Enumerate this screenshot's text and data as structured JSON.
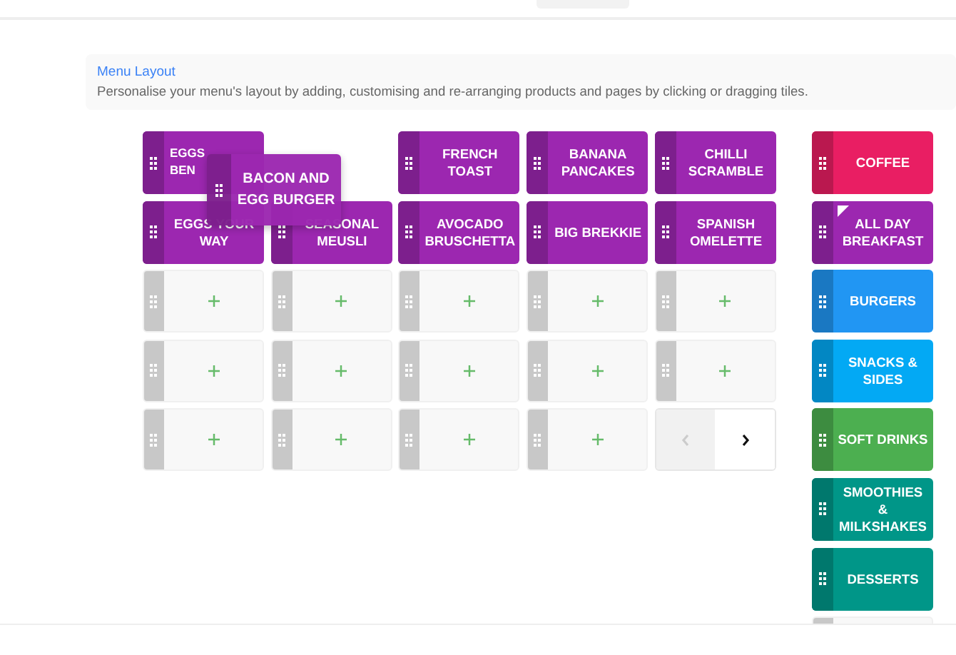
{
  "panel": {
    "title": "Menu Layout",
    "description": "Personalise your menu's layout by adding, customising and re-arranging products and pages by clicking or dragging tiles."
  },
  "grid": [
    {
      "kind": "product",
      "label": "EGGS BEN",
      "color": "#9c27b0"
    },
    {
      "kind": "vacant"
    },
    {
      "kind": "product",
      "label": "FRENCH TOAST",
      "color": "#9c27b0"
    },
    {
      "kind": "product",
      "label": "BANANA PANCAKES",
      "color": "#9c27b0"
    },
    {
      "kind": "product",
      "label": "CHILLI SCRAMBLE",
      "color": "#9c27b0"
    },
    {
      "kind": "product",
      "label": "EGGS YOUR WAY",
      "color": "#9c27b0"
    },
    {
      "kind": "product",
      "label": "SEASONAL MEUSLI",
      "color": "#9c27b0"
    },
    {
      "kind": "product",
      "label": "AVOCADO BRUSCHETTA",
      "color": "#9c27b0"
    },
    {
      "kind": "product",
      "label": "BIG BREKKIE",
      "color": "#9c27b0"
    },
    {
      "kind": "product",
      "label": "SPANISH OMELETTE",
      "color": "#9c27b0"
    },
    {
      "kind": "empty"
    },
    {
      "kind": "empty"
    },
    {
      "kind": "empty"
    },
    {
      "kind": "empty"
    },
    {
      "kind": "empty"
    },
    {
      "kind": "empty"
    },
    {
      "kind": "empty"
    },
    {
      "kind": "empty"
    },
    {
      "kind": "empty"
    },
    {
      "kind": "empty"
    },
    {
      "kind": "empty"
    },
    {
      "kind": "empty"
    },
    {
      "kind": "empty"
    },
    {
      "kind": "empty"
    },
    {
      "kind": "pager",
      "prev_disabled": true,
      "next_disabled": false
    }
  ],
  "dragging": {
    "label": "BACON AND EGG BURGER",
    "color": "#9c27b0"
  },
  "pages": [
    {
      "kind": "page",
      "label": "COFFEE",
      "color": "#e91e63",
      "selected": false
    },
    {
      "kind": "page",
      "label": "ALL DAY BREAKFAST",
      "color": "#9c27b0",
      "selected": true
    },
    {
      "kind": "page",
      "label": "BURGERS",
      "color": "#2196f3",
      "selected": false
    },
    {
      "kind": "page",
      "label": "SNACKS & SIDES",
      "color": "#03a9f4",
      "selected": false
    },
    {
      "kind": "page",
      "label": "SOFT DRINKS",
      "color": "#4caf50",
      "selected": false
    },
    {
      "kind": "page",
      "label": "SMOOTHIES & MILKSHAKES",
      "color": "#009688",
      "selected": false
    },
    {
      "kind": "page",
      "label": "DESSERTS",
      "color": "#009688",
      "selected": false
    },
    {
      "kind": "cut_off"
    }
  ]
}
